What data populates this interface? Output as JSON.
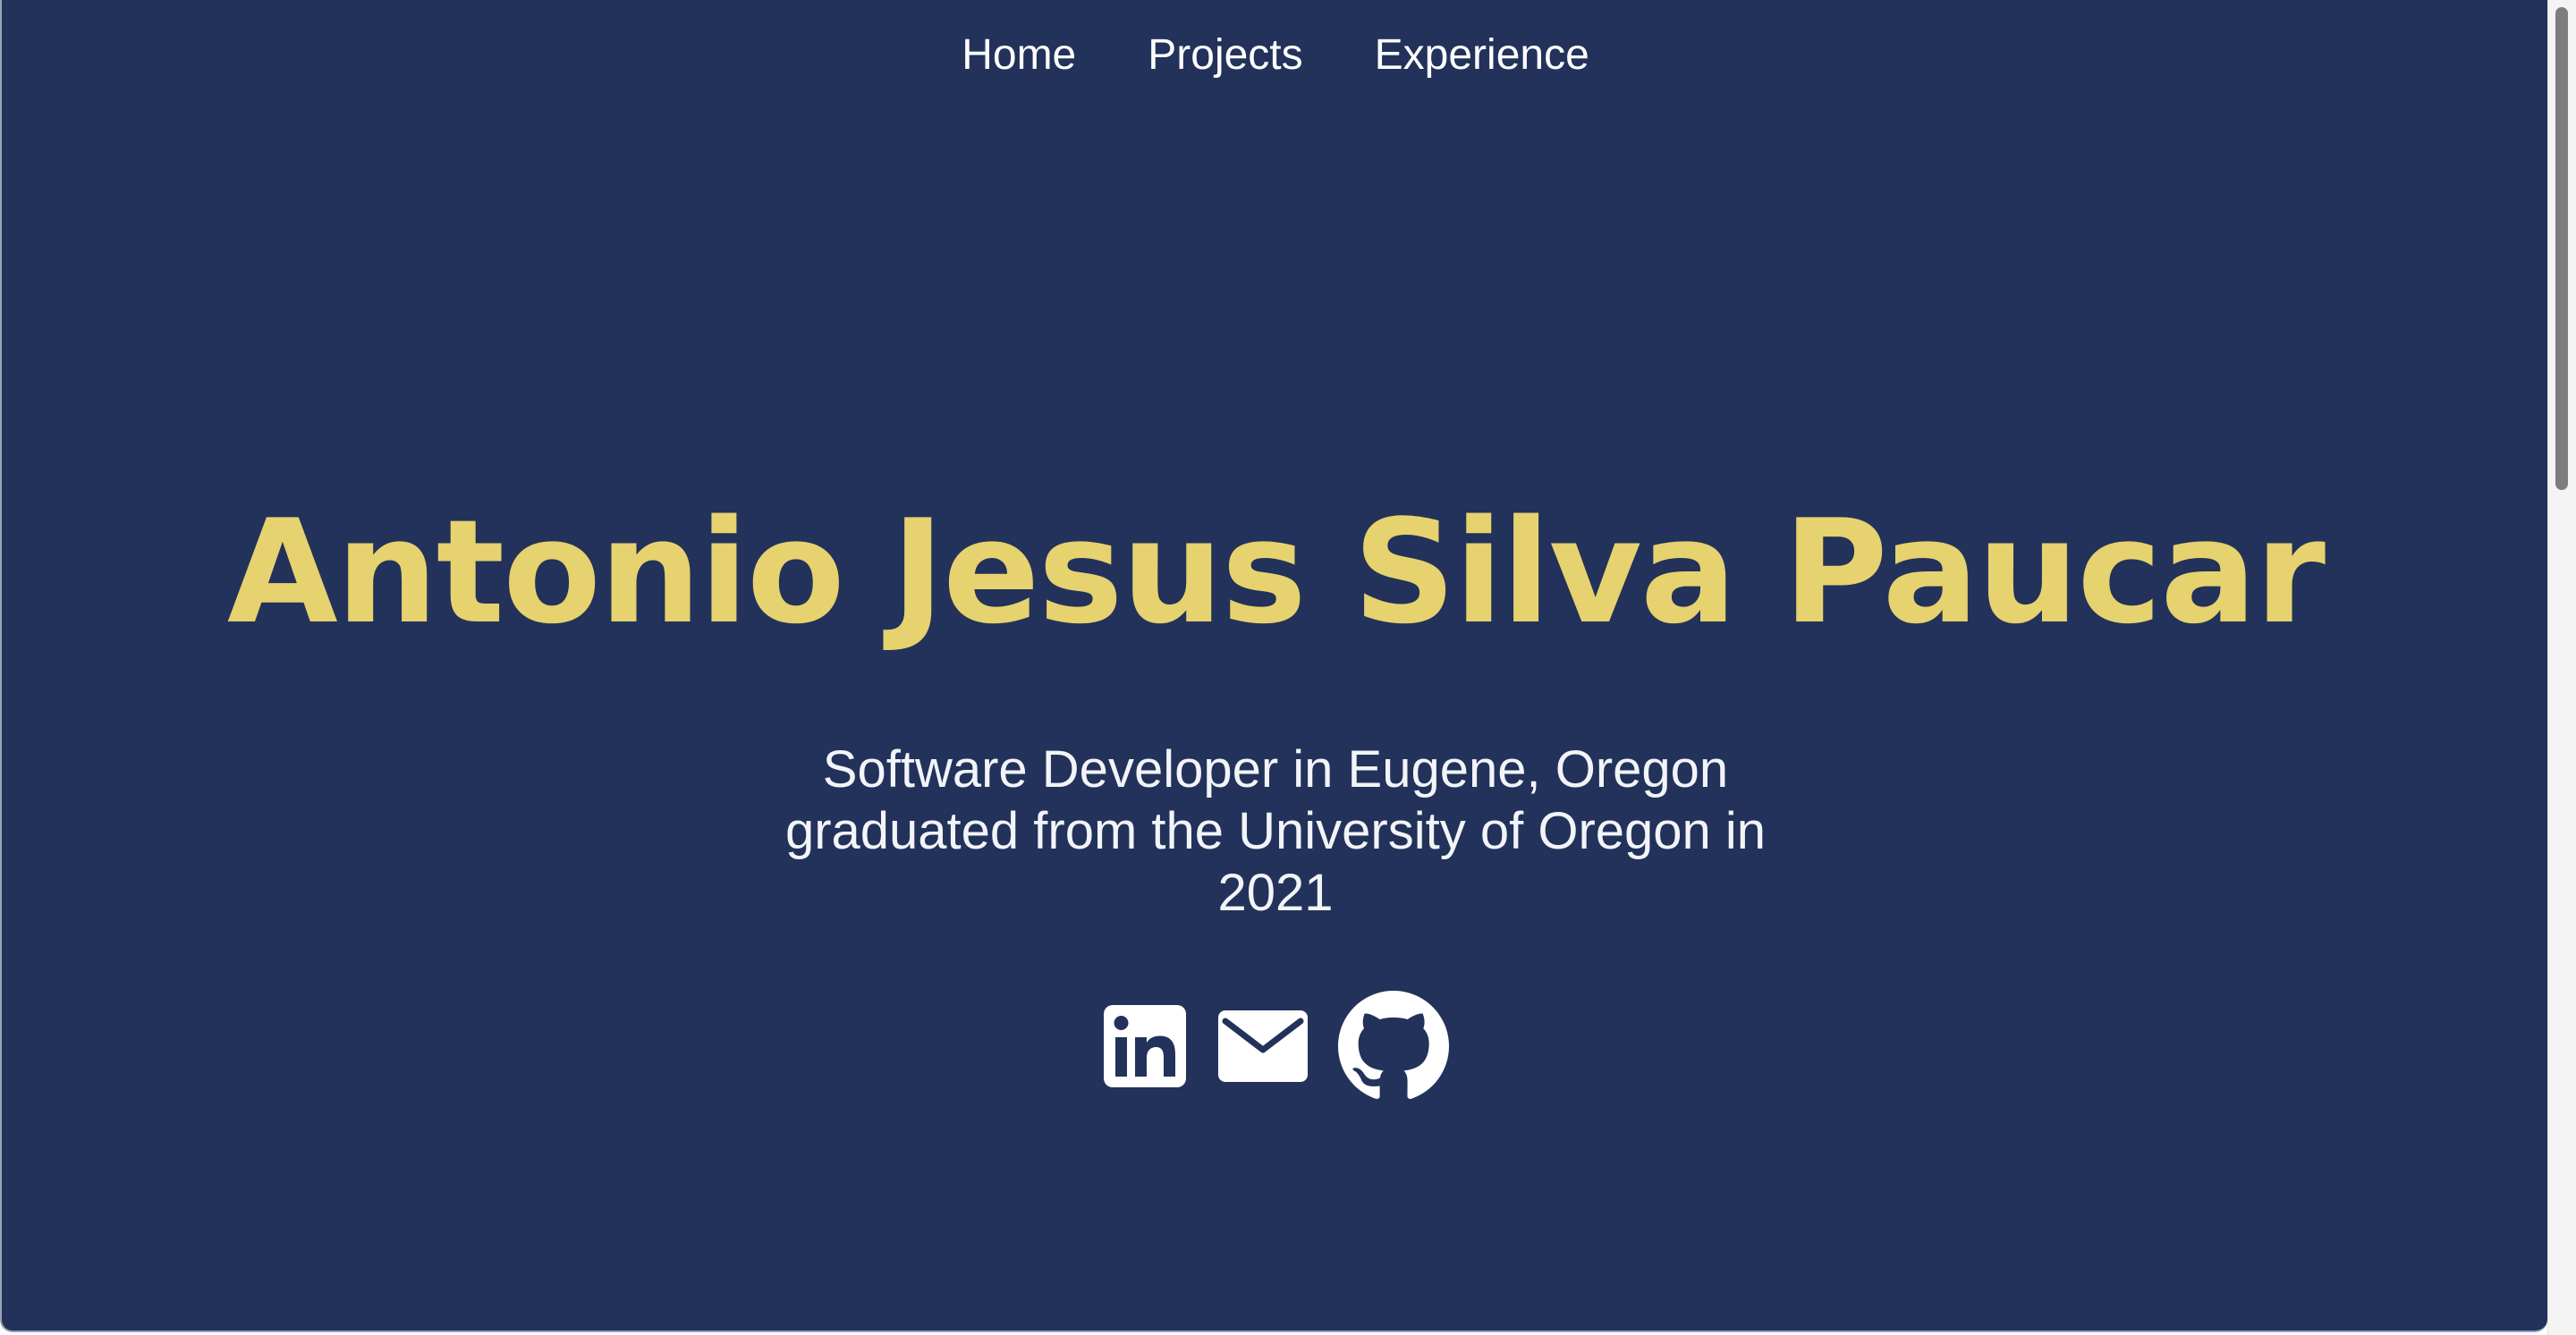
{
  "nav": {
    "items": [
      {
        "label": "Home"
      },
      {
        "label": "Projects"
      },
      {
        "label": "Experience"
      }
    ]
  },
  "hero": {
    "name": "Antonio Jesus Silva Paucar",
    "tagline_line1": "Software Developer in Eugene, Oregon",
    "tagline_line2": "graduated from the University of Oregon in",
    "tagline_line3": "2021"
  },
  "socials": [
    {
      "icon": "linkedin-icon"
    },
    {
      "icon": "mail-icon"
    },
    {
      "icon": "github-icon"
    }
  ],
  "colors": {
    "background": "#22325a",
    "name_accent": "#e6d26e",
    "text": "#ffffff"
  }
}
